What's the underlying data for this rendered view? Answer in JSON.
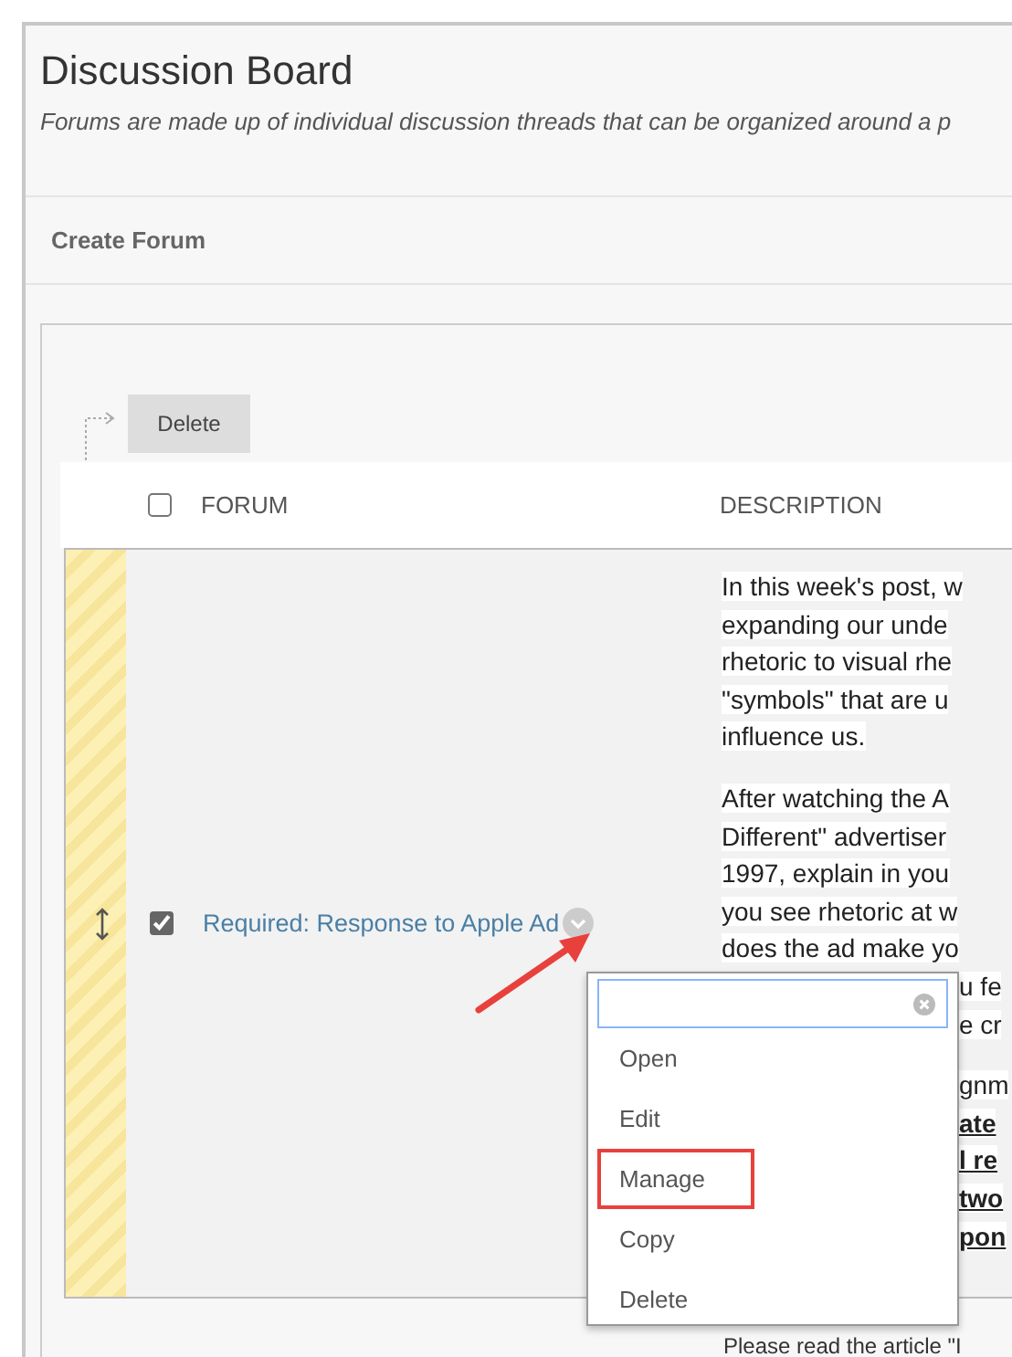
{
  "page": {
    "title": "Discussion Board",
    "subtitle": "Forums are made up of individual discussion threads that can be organized around a p"
  },
  "action_bar": {
    "button": "Create Forum"
  },
  "toolbar": {
    "button": "Delete"
  },
  "table": {
    "select_all": {
      "checked": false
    },
    "columns": [
      "FORUM",
      "DESCRIPTION"
    ],
    "rows": [
      {
        "selected": true,
        "title": "Required: Response to Apple Ad",
        "description": [
          [
            {
              "text": "In this week's post, w",
              "covered": false,
              "bold": false
            },
            {
              "text": "expanding our unde",
              "covered": false,
              "bold": false
            },
            {
              "text": "rhetoric to visual rhe",
              "covered": false,
              "bold": false
            },
            {
              "text": "\"symbols\" that are u",
              "covered": false,
              "bold": false
            },
            {
              "text": "influence us.",
              "covered": false,
              "bold": false
            }
          ],
          [
            {
              "text": "After watching the A",
              "covered": false,
              "bold": false
            },
            {
              "text": "Different\" advertiser",
              "covered": false,
              "bold": false
            },
            {
              "text": "1997, explain in you",
              "covered": false,
              "bold": false
            },
            {
              "text": "you see rhetoric at w",
              "covered": false,
              "bold": false
            },
            {
              "text": "does the ad make yo",
              "covered": false,
              "bold": false
            },
            {
              "text": "u fe",
              "covered": true,
              "bold": false
            },
            {
              "text": "e cr",
              "covered": true,
              "bold": false
            }
          ],
          [
            {
              "text": "gnm",
              "covered": true,
              "bold": false
            },
            {
              "text": "ate",
              "covered": true,
              "bold": true
            },
            {
              "text": "l re",
              "covered": true,
              "bold": true
            },
            {
              "text": "two",
              "covered": true,
              "bold": true
            },
            {
              "text": "pon",
              "covered": true,
              "bold": true
            }
          ]
        ]
      }
    ],
    "next_row_text": "Please read the article \"I"
  },
  "context_menu": {
    "items": [
      {
        "label": "Open",
        "highlighted": false
      },
      {
        "label": "Edit",
        "highlighted": false
      },
      {
        "label": "Manage",
        "highlighted": true
      },
      {
        "label": "Copy",
        "highlighted": false
      },
      {
        "label": "Delete",
        "highlighted": false
      }
    ]
  }
}
